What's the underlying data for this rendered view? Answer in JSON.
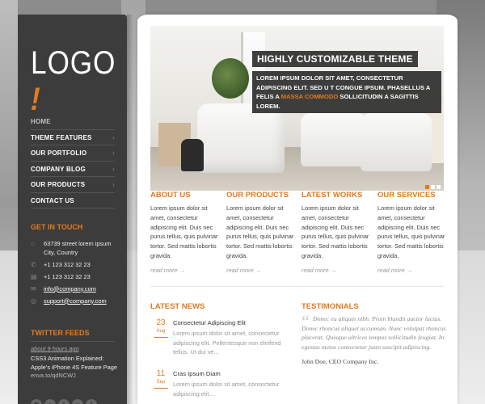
{
  "sidebar": {
    "logo_text": "LOGO",
    "logo_mark": "!",
    "nav": [
      {
        "label": "HOME"
      },
      {
        "label": "THEME FEATURES"
      },
      {
        "label": "OUR PORTFOLIO"
      },
      {
        "label": "COMPANY BLOG"
      },
      {
        "label": "OUR PRODUCTS"
      },
      {
        "label": "CONTACT US"
      }
    ],
    "contact_heading": "GET IN TOUCH",
    "contact": {
      "address_line1": "63739 street lorem ipsum",
      "address_line2": "City, Country",
      "phone": "+1 123 312 32 23",
      "fax": "+1 123 312 32 23",
      "email": "info@company.com",
      "support": "support@company.com"
    },
    "twitter_heading": "TWITTER FEEDS",
    "tweet": {
      "time": "about 9 hours ago",
      "line1": "CSS3 Animation Explained:",
      "line2": "Apple's iPhone 4S Feature Page",
      "link": "enva.to/qdNCWJ"
    },
    "social_icons": [
      "rss-icon",
      "dribbble-icon",
      "twitter-icon",
      "flickr-icon",
      "facebook-icon"
    ]
  },
  "slider": {
    "title": "HIGHLY CUSTOMIZABLE THEME",
    "text_before": "LOREM IPSUM DOLOR SIT AMET, CONSECTETUR ADIPISCING ELIT. SED U T CONGUE IPSUM. PHASELLUS A FELIS A ",
    "highlight": "MASSA COMMODO",
    "text_after": " SOLLICITUDIN A SAGITTIS LOREM.",
    "slide_count": 3,
    "active_slide": 1
  },
  "columns": [
    {
      "title": "ABOUT US",
      "text": "Lorem ipsum dolor sit amet, consectetur adipiscing elit. Duis nec purus tellus, quis pulvinar tortor. Sed mattis lobortis gravida.",
      "more": "read more"
    },
    {
      "title": "OUR PRODUCTS",
      "text": "Lorem ipsum dolor sit amet, consectetur adipiscing elit. Duis nec purus tellus, quis pulvinar tortor. Sed mattis lobortis gravida.",
      "more": "read more"
    },
    {
      "title": "LATEST WORKS",
      "text": "Lorem ipsum dolor sit amet, consectetur adipiscing elit. Duis nec purus tellus, quis pulvinar tortor. Sed mattis lobortis gravida.",
      "more": "read more"
    },
    {
      "title": "OUR SERVICES",
      "text": "Lorem ipsum dolor sit amet, consectetur adipiscing elit. Duis nec purus tellus, quis pulvinar tortor. Sed mattis lobortis gravida.",
      "more": "read more"
    }
  ],
  "latest_news": {
    "heading": "LATEST NEWS",
    "items": [
      {
        "day": "23",
        "month": "Aug",
        "title": "Consectetur Adipiscing Elit",
        "excerpt": "Lorem ipsum dolor sit amet, consectetur adipiscing elit. Pellentesque non eleifend tellus. Ut dui ve..."
      },
      {
        "day": "11",
        "month": "Sep",
        "title": "Cras Ipsum Diam",
        "excerpt": "Lorem ipsum dolor sit amet, consectetur adipiscing elit...."
      }
    ]
  },
  "testimonials": {
    "heading": "TESTIMONIALS",
    "quote": "Donec eu aliquet nibh. Proin blandit auctor luctus. Donec rhoncus aliquet accumsan. Nunc volutpat rhoncus placerat. Quisque ultrices tempus sollicitudin feugiat. In egestas metus consectetur justo suscipit adipiscing.",
    "author": "John Doe, CEO Company Inc."
  },
  "colors": {
    "accent": "#e07b21",
    "sidebar": "#3c3c3c"
  }
}
